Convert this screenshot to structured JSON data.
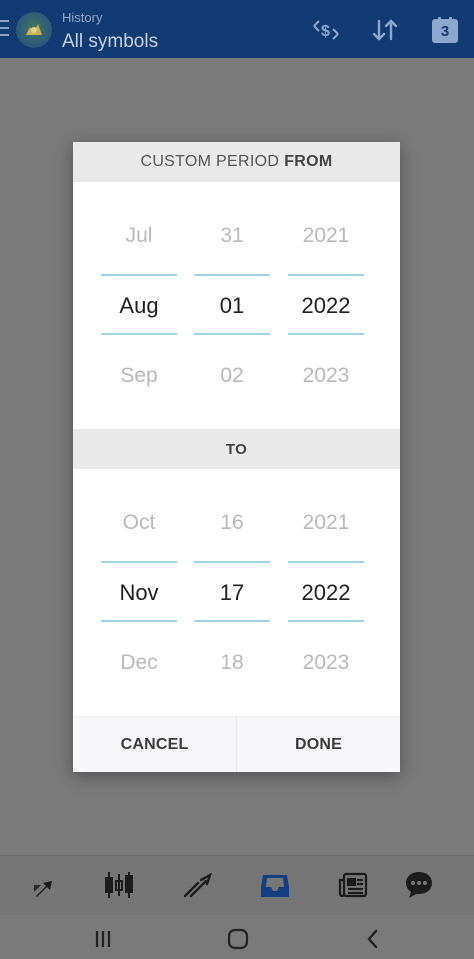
{
  "header": {
    "subtitle": "History",
    "title": "All symbols",
    "calendar_day": "3",
    "colors": {
      "bar": "#123a73",
      "icon": "#8da8cf"
    }
  },
  "dialog": {
    "from_heading_prefix": "CUSTOM PERIOD",
    "from_heading_bold": "FROM",
    "to_heading": "TO",
    "from": {
      "month": {
        "prev": "Jul",
        "selected": "Aug",
        "next": "Sep"
      },
      "day": {
        "prev": "31",
        "selected": "01",
        "next": "02"
      },
      "year": {
        "prev": "2021",
        "selected": "2022",
        "next": "2023"
      }
    },
    "to": {
      "month": {
        "prev": "Oct",
        "selected": "Nov",
        "next": "Dec"
      },
      "day": {
        "prev": "16",
        "selected": "17",
        "next": "18"
      },
      "year": {
        "prev": "2021",
        "selected": "2022",
        "next": "2023"
      }
    },
    "cancel_label": "CANCEL",
    "done_label": "DONE",
    "colors": {
      "selector_line": "#9fd3e6",
      "header_bg": "#e9e9e9"
    }
  },
  "toolbar": {
    "icons": [
      "quotes-arrows-icon",
      "candlestick-chart-icon",
      "trade-chart-icon",
      "history-inbox-icon",
      "news-icon",
      "chat-icon"
    ],
    "active_color": "#153f80"
  },
  "navbar": {
    "icons": [
      "recent-apps-icon",
      "home-icon",
      "back-icon"
    ]
  }
}
